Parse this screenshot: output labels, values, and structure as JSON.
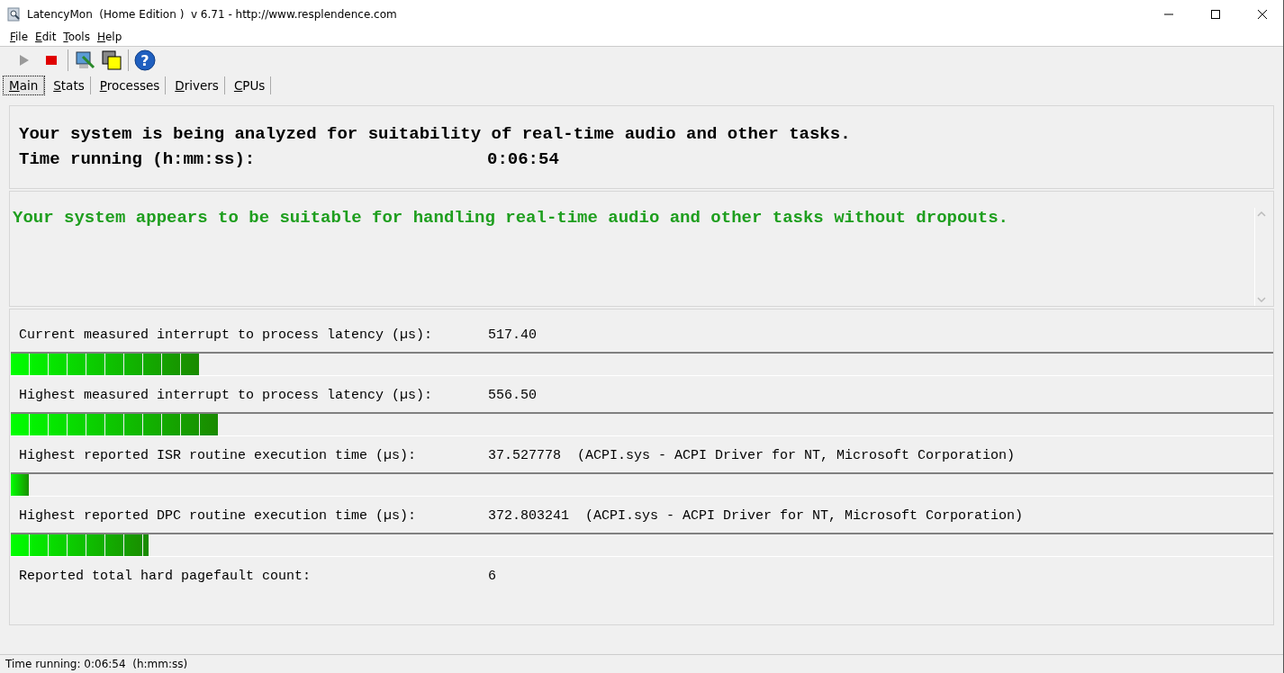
{
  "window": {
    "title": "LatencyMon  (Home Edition )  v 6.71 - http://www.resplendence.com"
  },
  "menu": [
    "File",
    "Edit",
    "Tools",
    "Help"
  ],
  "toolbar": {
    "help_glyph": "?"
  },
  "tabs": [
    {
      "label": "Main",
      "selected": true
    },
    {
      "label": "Stats",
      "selected": false
    },
    {
      "label": "Processes",
      "selected": false
    },
    {
      "label": "Drivers",
      "selected": false
    },
    {
      "label": "CPUs",
      "selected": false
    }
  ],
  "summary": {
    "heading": "Your system is being analyzed for suitability of real-time audio and other tasks.",
    "time_label": "Time running (h:mm:ss):",
    "time_value": "0:06:54"
  },
  "verdict": "Your system appears to be suitable for handling real-time audio and other tasks without dropouts.",
  "metrics": [
    {
      "label": "Current measured interrupt to process latency (µs):",
      "value": "517.40",
      "level": 0.149
    },
    {
      "label": "Highest measured interrupt to process latency (µs):",
      "value": "556.50",
      "level": 0.164
    },
    {
      "label": "Highest reported ISR routine execution time (µs):",
      "value": "37.527778  (ACPI.sys - ACPI Driver for NT, Microsoft Corporation)",
      "level": 0.015
    },
    {
      "label": "Highest reported DPC routine execution time (µs):",
      "value": "372.803241  (ACPI.sys - ACPI Driver for NT, Microsoft Corporation)",
      "level": 0.109
    }
  ],
  "pagefault": {
    "label": "Reported total hard pagefault count:",
    "value": "6"
  },
  "status_bar": "Time running: 0:06:54  (h:mm:ss)"
}
